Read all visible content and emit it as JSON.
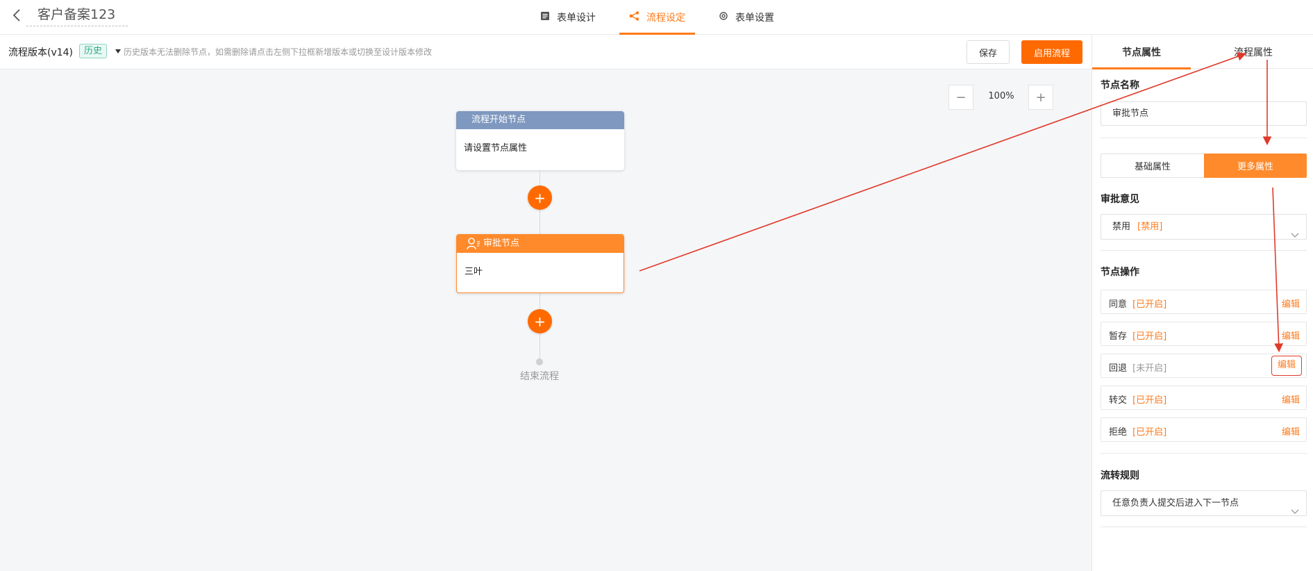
{
  "header": {
    "form_title": "客户备案123",
    "tabs": [
      {
        "label": "表单设计",
        "icon": "form-icon",
        "active": false
      },
      {
        "label": "流程设定",
        "icon": "flow-icon",
        "active": true
      },
      {
        "label": "表单设置",
        "icon": "settings-icon",
        "active": false
      }
    ]
  },
  "toolbar": {
    "version_label": "流程版本(v14)",
    "history_badge": "历史",
    "hint": "历史版本无法删除节点，如需删除请点击左侧下拉框新增版本或切换至设计版本修改",
    "save_label": "保存",
    "start_label": "启用流程"
  },
  "canvas": {
    "zoom": "100%",
    "start_node": {
      "title": "流程开始节点",
      "body": "请设置节点属性"
    },
    "approve_node": {
      "title": "审批节点",
      "body": "三叶"
    },
    "add_symbol": "+",
    "zoom_minus": "−",
    "zoom_plus": "+",
    "end_label": "结束流程"
  },
  "panel": {
    "tabs": {
      "node": "节点属性",
      "flow": "流程属性"
    },
    "node_name_title": "节点名称",
    "node_name_value": "审批节点",
    "segment": {
      "basic": "基础属性",
      "more": "更多属性"
    },
    "opinion_title": "审批意见",
    "opinion_value": "禁用",
    "opinion_tag": "[禁用]",
    "ops_title": "节点操作",
    "ops": [
      {
        "label": "同意",
        "status": "[已开启]",
        "enabled": true,
        "edit": "编辑"
      },
      {
        "label": "暂存",
        "status": "[已开启]",
        "enabled": true,
        "edit": "编辑"
      },
      {
        "label": "回退",
        "status": "[未开启]",
        "enabled": false,
        "edit": "编辑"
      },
      {
        "label": "转交",
        "status": "[已开启]",
        "enabled": true,
        "edit": "编辑"
      },
      {
        "label": "拒绝",
        "status": "[已开启]",
        "enabled": true,
        "edit": "编辑"
      }
    ],
    "rule_title": "流转规则",
    "rule_value": "任意负责人提交后进入下一节点"
  },
  "colors": {
    "accent": "#ff6a00",
    "annotation": "#e03a2a",
    "start_header": "#7f98bf"
  }
}
